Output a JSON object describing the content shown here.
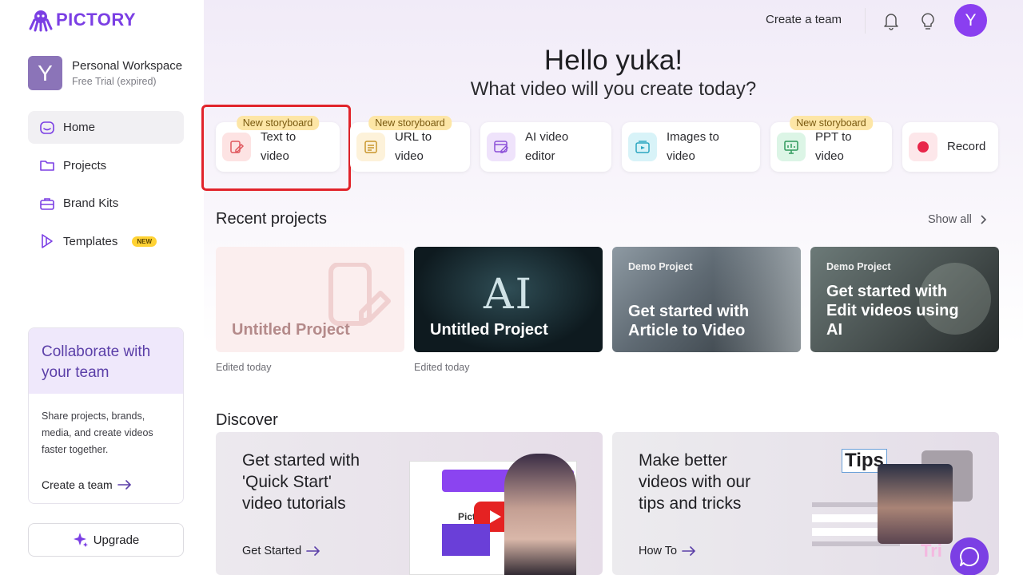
{
  "brand": {
    "name": "PICTORY",
    "color": "#7b3fe4"
  },
  "workspace": {
    "initial": "Y",
    "name": "Personal Workspace",
    "status": "Free Trial (expired)"
  },
  "nav": [
    {
      "label": "Home",
      "icon": "home-icon",
      "active": true
    },
    {
      "label": "Projects",
      "icon": "folder-icon"
    },
    {
      "label": "Brand Kits",
      "icon": "briefcase-icon"
    },
    {
      "label": "Templates",
      "icon": "templates-icon",
      "badge": "NEW"
    }
  ],
  "collab": {
    "title": "Collaborate with your team",
    "body": "Share projects, brands, media, and create videos faster together.",
    "link": "Create a team"
  },
  "upgrade": {
    "label": "Upgrade"
  },
  "topbar": {
    "create_team": "Create a team",
    "avatar_initial": "Y"
  },
  "greeting": {
    "hello": "Hello yuka!",
    "question": "What video will you create today?"
  },
  "tools": [
    {
      "label_1": "Text to",
      "label_2": "video",
      "badge": "New storyboard",
      "icon": "text-to-video-icon",
      "highlighted": true
    },
    {
      "label_1": "URL to",
      "label_2": "video",
      "badge": "New storyboard",
      "icon": "url-to-video-icon"
    },
    {
      "label_1": "AI video",
      "label_2": "editor",
      "icon": "ai-video-editor-icon"
    },
    {
      "label_1": "Images to",
      "label_2": "video",
      "icon": "images-to-video-icon"
    },
    {
      "label_1": "PPT to",
      "label_2": "video",
      "badge": "New storyboard",
      "icon": "ppt-to-video-icon"
    },
    {
      "label_1": "Record",
      "icon": "record-icon"
    }
  ],
  "recent": {
    "title": "Recent projects",
    "show_all": "Show all",
    "projects": [
      {
        "title": "Untitled Project",
        "edited": "Edited today"
      },
      {
        "title": "Untitled Project",
        "thumb_text": "AI",
        "edited": "Edited today"
      },
      {
        "tag": "Demo Project",
        "title_1": "Get started with",
        "title_2": "Article to Video"
      },
      {
        "tag": "Demo Project",
        "title_1": "Get started with",
        "title_2": "Edit videos using",
        "title_3": "AI"
      }
    ]
  },
  "discover": {
    "title": "Discover",
    "cards": [
      {
        "line_1": "Get started with",
        "line_2": "'Quick Start'",
        "line_3": "video tutorials",
        "link": "Get Started",
        "thumb_text": "Pictory"
      },
      {
        "line_1": "Make better",
        "line_2": "videos with our",
        "line_3": "tips and tricks",
        "link": "How To",
        "thumb_text": "Tips",
        "thumb_text_2": "Tri"
      }
    ]
  }
}
